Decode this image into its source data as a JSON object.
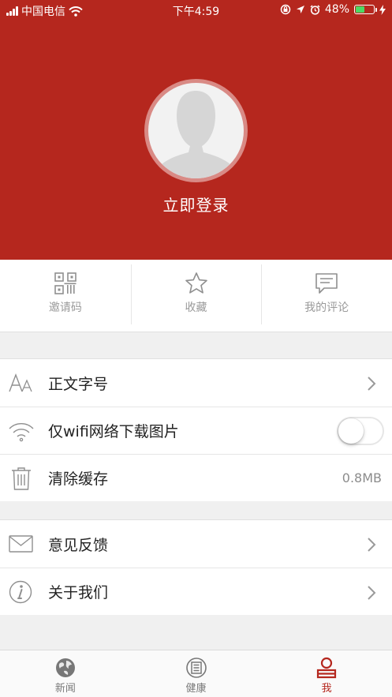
{
  "status_bar": {
    "carrier": "中国电信",
    "time": "下午4:59",
    "battery_percent": "48%",
    "battery_level": 0.48,
    "icons": [
      "signal-icon",
      "wifi-icon",
      "rotation-lock-icon",
      "location-icon",
      "alarm-icon",
      "battery-icon",
      "charging-icon"
    ]
  },
  "profile": {
    "login_label": "立即登录",
    "avatar_icon": "default-avatar-icon"
  },
  "quick_actions": [
    {
      "label": "邀请码",
      "icon": "qr-code-icon"
    },
    {
      "label": "收藏",
      "icon": "star-icon"
    },
    {
      "label": "我的评论",
      "icon": "comment-icon"
    }
  ],
  "settings": {
    "font_size": {
      "label": "正文字号",
      "icon": "font-size-icon"
    },
    "wifi_only": {
      "label": "仅wifi网络下载图片",
      "icon": "wifi-icon",
      "enabled": false
    },
    "clear_cache": {
      "label": "清除缓存",
      "icon": "trash-icon",
      "value": "0.8MB"
    },
    "feedback": {
      "label": "意见反馈",
      "icon": "mail-icon"
    },
    "about": {
      "label": "关于我们",
      "icon": "info-icon"
    }
  },
  "tab_bar": [
    {
      "label": "新闻",
      "icon": "globe-icon",
      "active": false
    },
    {
      "label": "健康",
      "icon": "health-icon",
      "active": false
    },
    {
      "label": "我",
      "icon": "user-icon",
      "active": true
    }
  ],
  "colors": {
    "brand_red": "#b5271e",
    "active_tab": "#b5271e",
    "battery_green": "#4cd964",
    "icon_gray": "#8f8f8f"
  }
}
